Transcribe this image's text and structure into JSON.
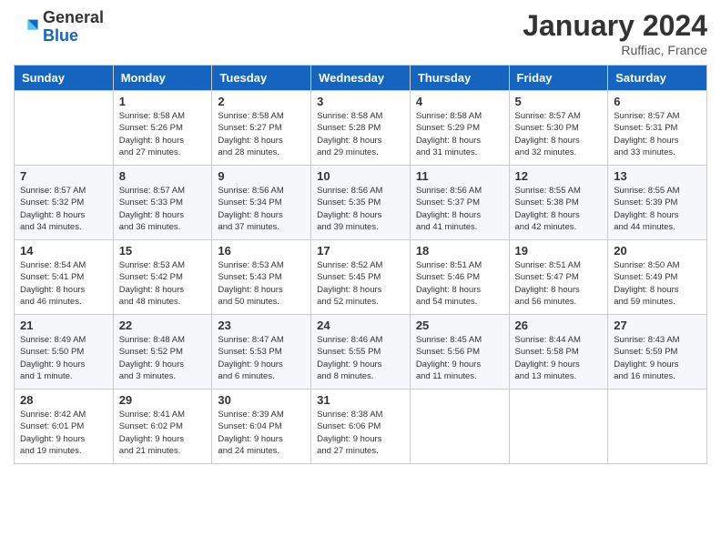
{
  "header": {
    "logo_general": "General",
    "logo_blue": "Blue",
    "month_title": "January 2024",
    "subtitle": "Ruffiac, France"
  },
  "days": [
    "Sunday",
    "Monday",
    "Tuesday",
    "Wednesday",
    "Thursday",
    "Friday",
    "Saturday"
  ],
  "weeks": [
    [
      {
        "date": "",
        "info": ""
      },
      {
        "date": "1",
        "info": "Sunrise: 8:58 AM\nSunset: 5:26 PM\nDaylight: 8 hours\nand 27 minutes."
      },
      {
        "date": "2",
        "info": "Sunrise: 8:58 AM\nSunset: 5:27 PM\nDaylight: 8 hours\nand 28 minutes."
      },
      {
        "date": "3",
        "info": "Sunrise: 8:58 AM\nSunset: 5:28 PM\nDaylight: 8 hours\nand 29 minutes."
      },
      {
        "date": "4",
        "info": "Sunrise: 8:58 AM\nSunset: 5:29 PM\nDaylight: 8 hours\nand 31 minutes."
      },
      {
        "date": "5",
        "info": "Sunrise: 8:57 AM\nSunset: 5:30 PM\nDaylight: 8 hours\nand 32 minutes."
      },
      {
        "date": "6",
        "info": "Sunrise: 8:57 AM\nSunset: 5:31 PM\nDaylight: 8 hours\nand 33 minutes."
      }
    ],
    [
      {
        "date": "7",
        "info": "Sunrise: 8:57 AM\nSunset: 5:32 PM\nDaylight: 8 hours\nand 34 minutes."
      },
      {
        "date": "8",
        "info": "Sunrise: 8:57 AM\nSunset: 5:33 PM\nDaylight: 8 hours\nand 36 minutes."
      },
      {
        "date": "9",
        "info": "Sunrise: 8:56 AM\nSunset: 5:34 PM\nDaylight: 8 hours\nand 37 minutes."
      },
      {
        "date": "10",
        "info": "Sunrise: 8:56 AM\nSunset: 5:35 PM\nDaylight: 8 hours\nand 39 minutes."
      },
      {
        "date": "11",
        "info": "Sunrise: 8:56 AM\nSunset: 5:37 PM\nDaylight: 8 hours\nand 41 minutes."
      },
      {
        "date": "12",
        "info": "Sunrise: 8:55 AM\nSunset: 5:38 PM\nDaylight: 8 hours\nand 42 minutes."
      },
      {
        "date": "13",
        "info": "Sunrise: 8:55 AM\nSunset: 5:39 PM\nDaylight: 8 hours\nand 44 minutes."
      }
    ],
    [
      {
        "date": "14",
        "info": "Sunrise: 8:54 AM\nSunset: 5:41 PM\nDaylight: 8 hours\nand 46 minutes."
      },
      {
        "date": "15",
        "info": "Sunrise: 8:53 AM\nSunset: 5:42 PM\nDaylight: 8 hours\nand 48 minutes."
      },
      {
        "date": "16",
        "info": "Sunrise: 8:53 AM\nSunset: 5:43 PM\nDaylight: 8 hours\nand 50 minutes."
      },
      {
        "date": "17",
        "info": "Sunrise: 8:52 AM\nSunset: 5:45 PM\nDaylight: 8 hours\nand 52 minutes."
      },
      {
        "date": "18",
        "info": "Sunrise: 8:51 AM\nSunset: 5:46 PM\nDaylight: 8 hours\nand 54 minutes."
      },
      {
        "date": "19",
        "info": "Sunrise: 8:51 AM\nSunset: 5:47 PM\nDaylight: 8 hours\nand 56 minutes."
      },
      {
        "date": "20",
        "info": "Sunrise: 8:50 AM\nSunset: 5:49 PM\nDaylight: 8 hours\nand 59 minutes."
      }
    ],
    [
      {
        "date": "21",
        "info": "Sunrise: 8:49 AM\nSunset: 5:50 PM\nDaylight: 9 hours\nand 1 minute."
      },
      {
        "date": "22",
        "info": "Sunrise: 8:48 AM\nSunset: 5:52 PM\nDaylight: 9 hours\nand 3 minutes."
      },
      {
        "date": "23",
        "info": "Sunrise: 8:47 AM\nSunset: 5:53 PM\nDaylight: 9 hours\nand 6 minutes."
      },
      {
        "date": "24",
        "info": "Sunrise: 8:46 AM\nSunset: 5:55 PM\nDaylight: 9 hours\nand 8 minutes."
      },
      {
        "date": "25",
        "info": "Sunrise: 8:45 AM\nSunset: 5:56 PM\nDaylight: 9 hours\nand 11 minutes."
      },
      {
        "date": "26",
        "info": "Sunrise: 8:44 AM\nSunset: 5:58 PM\nDaylight: 9 hours\nand 13 minutes."
      },
      {
        "date": "27",
        "info": "Sunrise: 8:43 AM\nSunset: 5:59 PM\nDaylight: 9 hours\nand 16 minutes."
      }
    ],
    [
      {
        "date": "28",
        "info": "Sunrise: 8:42 AM\nSunset: 6:01 PM\nDaylight: 9 hours\nand 19 minutes."
      },
      {
        "date": "29",
        "info": "Sunrise: 8:41 AM\nSunset: 6:02 PM\nDaylight: 9 hours\nand 21 minutes."
      },
      {
        "date": "30",
        "info": "Sunrise: 8:39 AM\nSunset: 6:04 PM\nDaylight: 9 hours\nand 24 minutes."
      },
      {
        "date": "31",
        "info": "Sunrise: 8:38 AM\nSunset: 6:06 PM\nDaylight: 9 hours\nand 27 minutes."
      },
      {
        "date": "",
        "info": ""
      },
      {
        "date": "",
        "info": ""
      },
      {
        "date": "",
        "info": ""
      }
    ]
  ]
}
